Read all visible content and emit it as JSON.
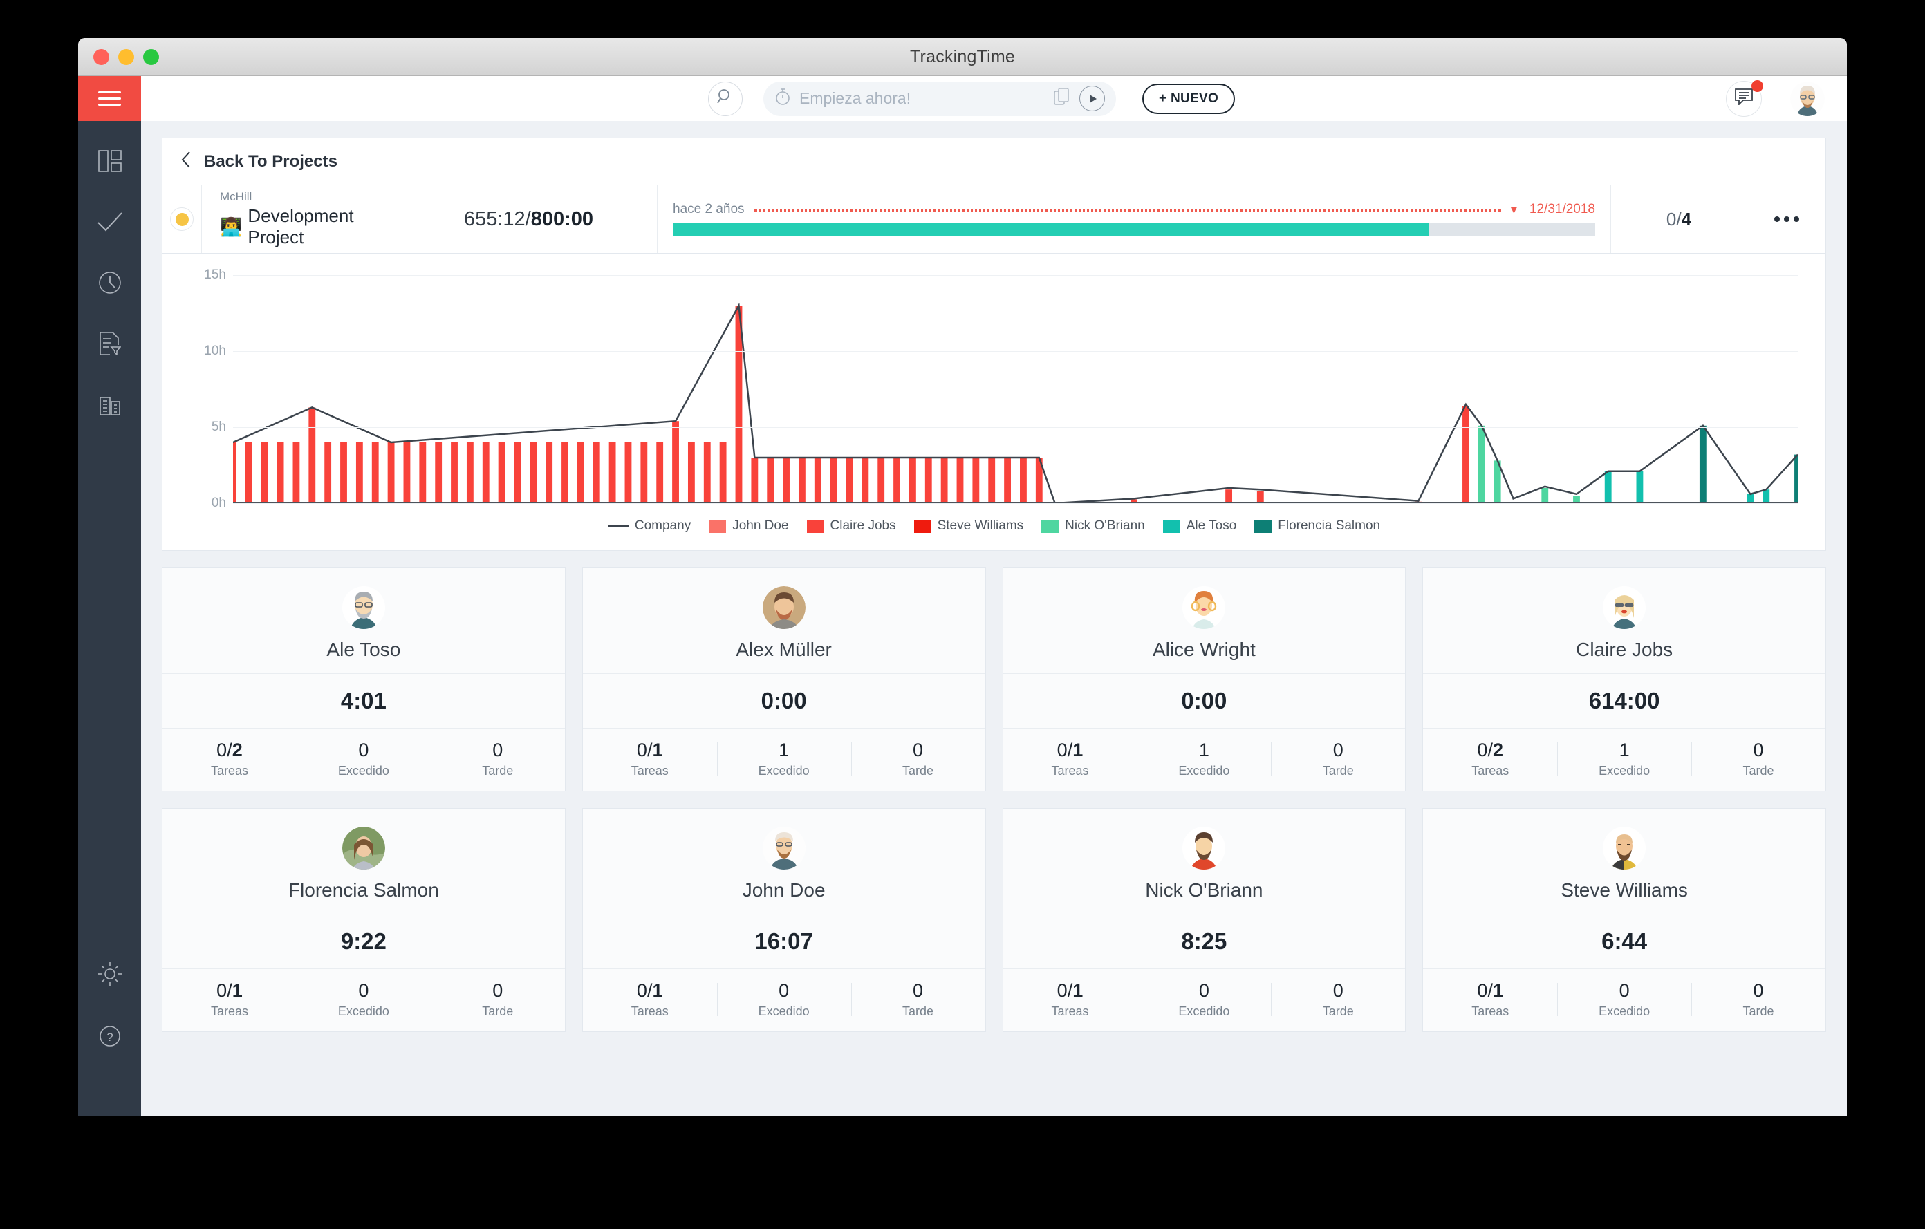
{
  "window": {
    "title": "TrackingTime"
  },
  "sidebar": {
    "items": [
      {
        "name": "menu-toggle",
        "label": "Menu"
      },
      {
        "name": "dashboard",
        "label": "Dashboard"
      },
      {
        "name": "tasks",
        "label": "Tasks"
      },
      {
        "name": "timesheets",
        "label": "Timesheets"
      },
      {
        "name": "reports",
        "label": "Reports"
      },
      {
        "name": "company",
        "label": "Company"
      }
    ],
    "bottom": [
      {
        "name": "whats-new",
        "label": "What's New"
      },
      {
        "name": "help",
        "label": "Help"
      }
    ]
  },
  "topbar": {
    "timer_placeholder": "Empieza ahora!",
    "new_button": "+ NUEVO",
    "search_label": "Search",
    "notifications": true
  },
  "breadcrumb": {
    "back_label": "Back To Projects"
  },
  "project": {
    "status_color": "#f6c445",
    "client": "McHill",
    "name": "Development Project",
    "emoji": "👨‍💻",
    "hours_logged": "655:12",
    "hours_separator": " / ",
    "hours_budget": "800:00",
    "time_ago": "hace 2 años",
    "due_date": "12/31/2018",
    "progress_percent": 82,
    "tasks_done": "0",
    "tasks_separator": " / ",
    "tasks_total": "4",
    "more_label": "More options"
  },
  "chart_data": {
    "type": "area",
    "title": "",
    "xlabel": "",
    "ylabel": "",
    "ylim": [
      0,
      15
    ],
    "yticks": [
      0,
      5,
      10,
      15
    ],
    "ytick_labels": [
      "0h",
      "5h",
      "10h",
      "15h"
    ],
    "grid": true,
    "legend_position": "bottom",
    "legend": [
      {
        "name": "Company",
        "color": "#3c444d",
        "marker": "line"
      },
      {
        "name": "John Doe",
        "color": "#fa7268",
        "marker": "box"
      },
      {
        "name": "Claire Jobs",
        "color": "#f9423a",
        "marker": "box"
      },
      {
        "name": "Steve Williams",
        "color": "#ef1b0e",
        "marker": "box"
      },
      {
        "name": "Nick O'Briann",
        "color": "#4ed6a0",
        "marker": "box"
      },
      {
        "name": "Ale Toso",
        "color": "#12c0ae",
        "marker": "box"
      },
      {
        "name": "Florencia Salmon",
        "color": "#0d7f75",
        "marker": "box"
      }
    ],
    "series": [
      {
        "name": "Claire Jobs",
        "color": "#f9423a",
        "points": [
          [
            0,
            4
          ],
          [
            1,
            4
          ],
          [
            2,
            4
          ],
          [
            3,
            4
          ],
          [
            4,
            4
          ],
          [
            5,
            6.3
          ],
          [
            6,
            4
          ],
          [
            7,
            4
          ],
          [
            8,
            4
          ],
          [
            9,
            4
          ],
          [
            10,
            4
          ],
          [
            11,
            4
          ],
          [
            12,
            4
          ],
          [
            13,
            4
          ],
          [
            14,
            4
          ],
          [
            15,
            4
          ],
          [
            16,
            4
          ],
          [
            17,
            4
          ],
          [
            18,
            4
          ],
          [
            19,
            4
          ],
          [
            20,
            4
          ],
          [
            21,
            4
          ],
          [
            22,
            4
          ],
          [
            23,
            4
          ],
          [
            24,
            4
          ],
          [
            25,
            4
          ],
          [
            26,
            4
          ],
          [
            27,
            4
          ],
          [
            28,
            5.4
          ],
          [
            29,
            4
          ],
          [
            30,
            4
          ],
          [
            31,
            4
          ],
          [
            32,
            13
          ],
          [
            33,
            3
          ],
          [
            34,
            3
          ],
          [
            35,
            3
          ],
          [
            36,
            3
          ],
          [
            37,
            3
          ],
          [
            38,
            3
          ],
          [
            39,
            3
          ],
          [
            40,
            3
          ],
          [
            41,
            3
          ],
          [
            42,
            3
          ],
          [
            43,
            3
          ],
          [
            44,
            3
          ],
          [
            45,
            3
          ],
          [
            46,
            3
          ],
          [
            47,
            3
          ],
          [
            48,
            3
          ],
          [
            49,
            3
          ],
          [
            50,
            3
          ],
          [
            51,
            3
          ],
          [
            52,
            0
          ],
          [
            53,
            0
          ],
          [
            54,
            0
          ],
          [
            55,
            0
          ],
          [
            56,
            0
          ],
          [
            57,
            0.25
          ],
          [
            58,
            0
          ],
          [
            59,
            0
          ],
          [
            60,
            0
          ],
          [
            61,
            0
          ],
          [
            62,
            0
          ],
          [
            63,
            0.9
          ],
          [
            64,
            0
          ],
          [
            65,
            0.8
          ],
          [
            66,
            0
          ],
          [
            67,
            0
          ],
          [
            68,
            0
          ],
          [
            69,
            0
          ],
          [
            70,
            0
          ],
          [
            71,
            0
          ],
          [
            72,
            0
          ],
          [
            73,
            0
          ],
          [
            74,
            0
          ],
          [
            75,
            0.1
          ],
          [
            76,
            0
          ],
          [
            77,
            0
          ],
          [
            78,
            6.4
          ],
          [
            79,
            0.4
          ],
          [
            80,
            0
          ],
          [
            81,
            0
          ],
          [
            82,
            0
          ],
          [
            83,
            0
          ],
          [
            84,
            0
          ],
          [
            85,
            0
          ],
          [
            86,
            0
          ],
          [
            87,
            0
          ],
          [
            88,
            0
          ],
          [
            89,
            0
          ],
          [
            90,
            0
          ],
          [
            91,
            0
          ],
          [
            92,
            0
          ],
          [
            93,
            0
          ],
          [
            94,
            0
          ],
          [
            95,
            0
          ],
          [
            96,
            0
          ],
          [
            97,
            0
          ],
          [
            98,
            0
          ],
          [
            99,
            0
          ]
        ]
      },
      {
        "name": "Company",
        "color": "#3c444d",
        "points": [
          [
            0,
            4
          ],
          [
            5,
            6.3
          ],
          [
            10,
            4
          ],
          [
            28,
            5.4
          ],
          [
            32,
            13
          ],
          [
            33,
            3
          ],
          [
            51,
            3
          ],
          [
            52,
            0
          ],
          [
            57,
            0.3
          ],
          [
            63,
            1
          ],
          [
            65,
            0.9
          ],
          [
            75,
            0.15
          ],
          [
            78,
            6.5
          ],
          [
            79,
            5.1
          ],
          [
            80,
            2.8
          ],
          [
            81,
            0.3
          ],
          [
            83,
            1.1
          ],
          [
            85,
            0.6
          ],
          [
            87,
            2.1
          ],
          [
            89,
            2.1
          ],
          [
            93,
            5.1
          ],
          [
            96,
            0.6
          ],
          [
            97,
            0.9
          ],
          [
            99,
            3.2
          ]
        ]
      },
      {
        "name": "Nick O'Briann",
        "color": "#4ed6a0",
        "points": [
          [
            79,
            5.1
          ],
          [
            80,
            2.8
          ],
          [
            83,
            1.0
          ],
          [
            85,
            0.5
          ]
        ]
      },
      {
        "name": "Ale Toso",
        "color": "#12c0ae",
        "points": [
          [
            87,
            2.1
          ],
          [
            89,
            2.1
          ],
          [
            96,
            0.6
          ],
          [
            97,
            0.9
          ]
        ]
      },
      {
        "name": "Florencia Salmon",
        "color": "#0d7f75",
        "points": [
          [
            93,
            5.1
          ],
          [
            99,
            3.2
          ]
        ]
      }
    ]
  },
  "members": [
    {
      "name": "Ale Toso",
      "avatar": "ale-toso",
      "time": "4:01",
      "tasks_done": "0/",
      "tasks_total": "2",
      "tasks_label": "Tareas",
      "exceeded": "0",
      "exceeded_label": "Excedido",
      "late": "0",
      "late_label": "Tarde"
    },
    {
      "name": "Alex Müller",
      "avatar": "alex-muller",
      "time": "0:00",
      "tasks_done": "0/",
      "tasks_total": "1",
      "tasks_label": "Tareas",
      "exceeded": "1",
      "exceeded_label": "Excedido",
      "late": "0",
      "late_label": "Tarde"
    },
    {
      "name": "Alice Wright",
      "avatar": "alice-wright",
      "time": "0:00",
      "tasks_done": "0/",
      "tasks_total": "1",
      "tasks_label": "Tareas",
      "exceeded": "1",
      "exceeded_label": "Excedido",
      "late": "0",
      "late_label": "Tarde"
    },
    {
      "name": "Claire Jobs",
      "avatar": "claire-jobs",
      "time": "614:00",
      "tasks_done": "0/",
      "tasks_total": "2",
      "tasks_label": "Tareas",
      "exceeded": "1",
      "exceeded_label": "Excedido",
      "late": "0",
      "late_label": "Tarde"
    },
    {
      "name": "Florencia Salmon",
      "avatar": "florencia-salmon",
      "time": "9:22",
      "tasks_done": "0/",
      "tasks_total": "1",
      "tasks_label": "Tareas",
      "exceeded": "0",
      "exceeded_label": "Excedido",
      "late": "0",
      "late_label": "Tarde"
    },
    {
      "name": "John Doe",
      "avatar": "john-doe",
      "time": "16:07",
      "tasks_done": "0/",
      "tasks_total": "1",
      "tasks_label": "Tareas",
      "exceeded": "0",
      "exceeded_label": "Excedido",
      "late": "0",
      "late_label": "Tarde"
    },
    {
      "name": "Nick O'Briann",
      "avatar": "nick-obriann",
      "time": "8:25",
      "tasks_done": "0/",
      "tasks_total": "1",
      "tasks_label": "Tareas",
      "exceeded": "0",
      "exceeded_label": "Excedido",
      "late": "0",
      "late_label": "Tarde"
    },
    {
      "name": "Steve Williams",
      "avatar": "steve-williams",
      "time": "6:44",
      "tasks_done": "0/",
      "tasks_total": "1",
      "tasks_label": "Tareas",
      "exceeded": "0",
      "exceeded_label": "Excedido",
      "late": "0",
      "late_label": "Tarde"
    }
  ]
}
